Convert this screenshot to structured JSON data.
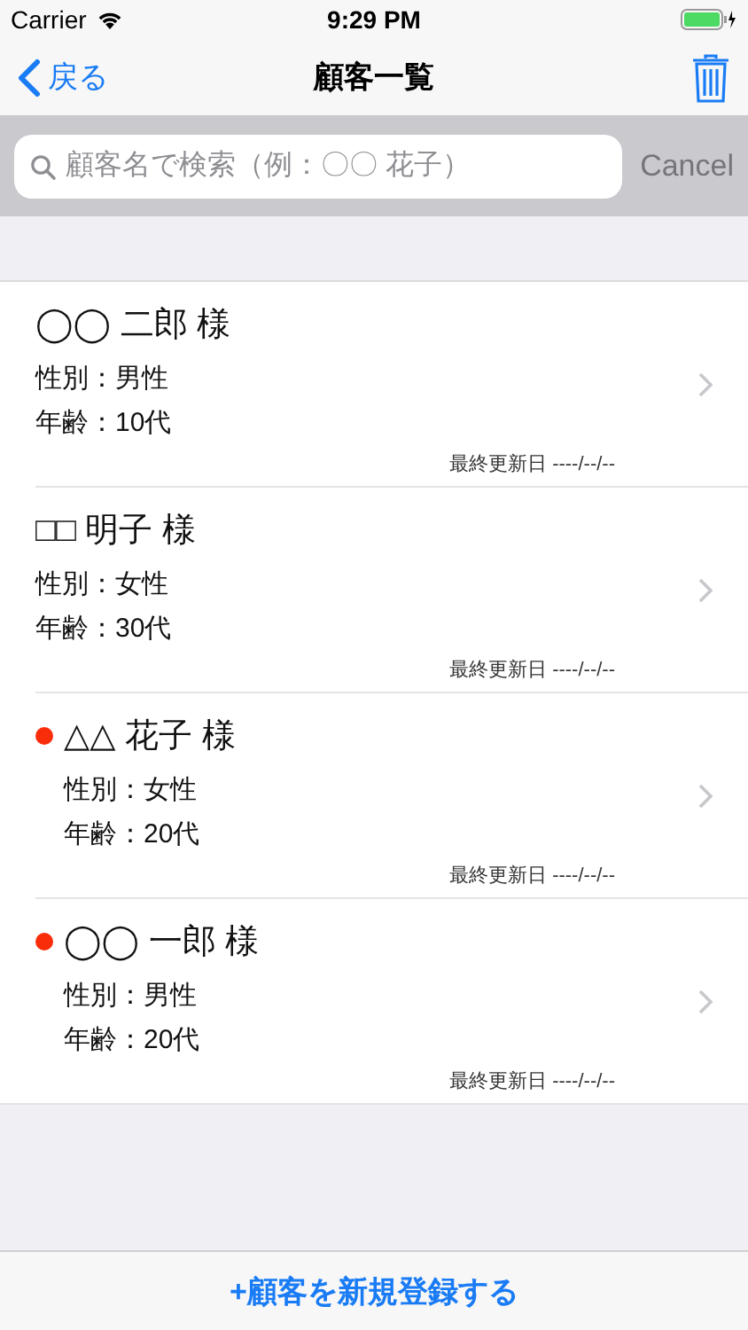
{
  "status_bar": {
    "carrier": "Carrier",
    "time": "9:29 PM"
  },
  "nav": {
    "back": "戻る",
    "title": "顧客一覧"
  },
  "search": {
    "placeholder": "顧客名で検索（例：〇〇 花子）",
    "cancel": "Cancel"
  },
  "customers": [
    {
      "name": "◯◯ 二郎 様",
      "gender": "性別：男性",
      "age": "年齢：10代",
      "updated": "最終更新日 ----/--/--",
      "flagged": false
    },
    {
      "name": "□□ 明子 様",
      "gender": "性別：女性",
      "age": "年齢：30代",
      "updated": "最終更新日 ----/--/--",
      "flagged": false
    },
    {
      "name": "△△ 花子 様",
      "gender": "性別：女性",
      "age": "年齢：20代",
      "updated": "最終更新日 ----/--/--",
      "flagged": true
    },
    {
      "name": "◯◯ 一郎 様",
      "gender": "性別：男性",
      "age": "年齢：20代",
      "updated": "最終更新日 ----/--/--",
      "flagged": true
    }
  ],
  "footer": {
    "button": "+顧客を新規登録する"
  }
}
